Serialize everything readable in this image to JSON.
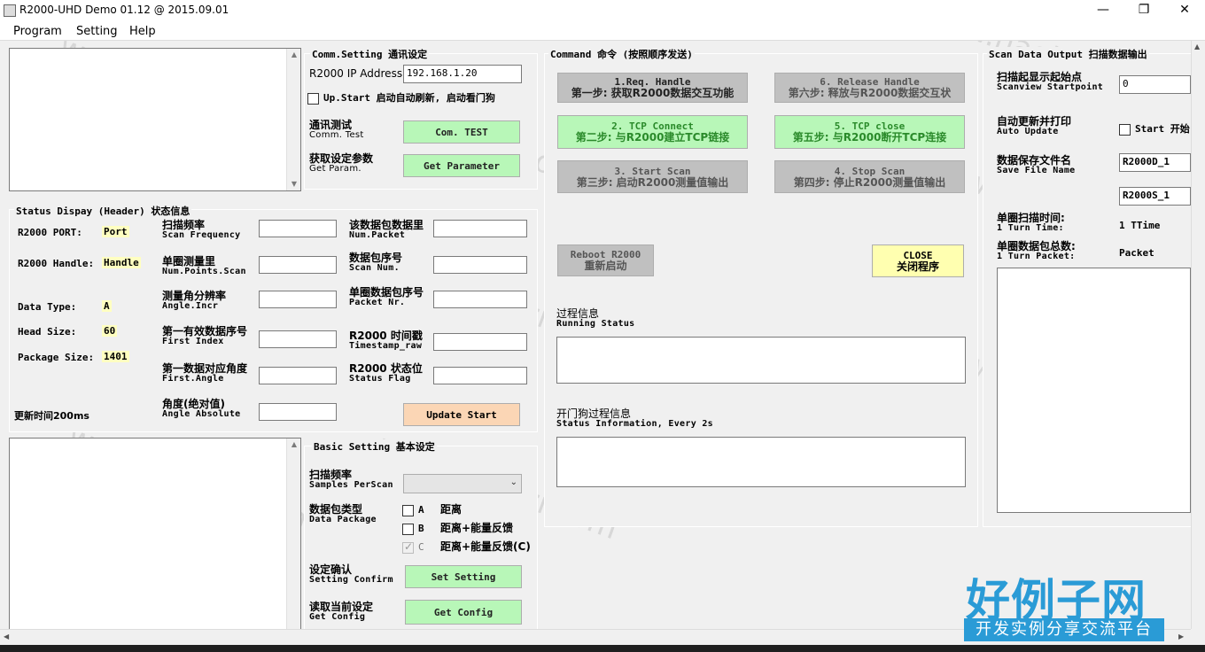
{
  "window": {
    "title": "R2000-UHD Demo 01.12 @ 2015.09.01",
    "minimize": "—",
    "maximize": "❐",
    "close": "✕"
  },
  "menu": [
    "Program",
    "Setting",
    "Help"
  ],
  "comm": {
    "title": "Comm.Setting 通讯设定",
    "ip_label": "R2000 IP Address",
    "ip_value": "192.168.1.20",
    "upstart_label": "Up.Start 启动自动刷新, 启动看门狗",
    "test_zh": "通讯测试",
    "test_en": "Comm. Test",
    "test_btn": "Com. TEST",
    "param_zh": "获取设定参数",
    "param_en": "Get Param.",
    "param_btn": "Get Parameter"
  },
  "status": {
    "title": "Status Dispay (Header) 状态信息",
    "port_label": "R2000 PORT:",
    "port_value": "Port",
    "handle_label": "R2000 Handle:",
    "handle_value": "Handle",
    "dtype_label": "Data Type:",
    "dtype_value": "A",
    "head_label": "Head Size:",
    "head_value": "60",
    "pkg_label": "Package Size:",
    "pkg_value": "1401",
    "refresh_label": "更新时间200ms",
    "fields": [
      {
        "zh": "扫描频率",
        "en": "Scan Frequency"
      },
      {
        "zh": "单圈测量里",
        "en": "Num.Points.Scan"
      },
      {
        "zh": "测量角分辨率",
        "en": "Angle.Incr"
      },
      {
        "zh": "第一有效数据序号",
        "en": "First Index"
      },
      {
        "zh": "第一数据对应角度",
        "en": "First.Angle"
      },
      {
        "zh": "角度(绝对值)",
        "en": "Angle Absolute"
      }
    ],
    "fields2": [
      {
        "zh": "该数据包数据里",
        "en": "Num.Packet"
      },
      {
        "zh": "数据包序号",
        "en": "Scan Num."
      },
      {
        "zh": "单圈数据包序号",
        "en": "Packet Nr."
      },
      {
        "zh": "R2000 时间戳",
        "en": "Timestamp_raw"
      },
      {
        "zh": "R2000 状态位",
        "en": "Status Flag"
      }
    ],
    "update_btn": "Update Start"
  },
  "basic": {
    "title": "Basic Setting 基本设定",
    "samples_zh": "扫描频率",
    "samples_en": "Samples PerScan",
    "pkg_zh": "数据包类型",
    "pkg_en": "Data Package",
    "opt_a": "A",
    "opt_a_desc": "距离",
    "opt_b": "B",
    "opt_b_desc": "距离+能量反馈",
    "opt_c": "C",
    "opt_c_desc": "距离+能量反馈(C)",
    "confirm_zh": "设定确认",
    "confirm_en": "Setting Confirm",
    "set_btn": "Set Setting",
    "read_zh": "读取当前设定",
    "read_en": "Get Config",
    "get_btn": "Get Config"
  },
  "command": {
    "title": "Command 命令 (按照顺序发送)",
    "b1_en": "1.Req. Handle",
    "b1_zh": "第一步: 获取R2000数据交互功能",
    "b2_en": "2. TCP Connect",
    "b2_zh": "第二步: 与R2000建立TCP链接",
    "b3_en": "3. Start Scan",
    "b3_zh": "第三步: 启动R2000测量值输出",
    "b4_en": "4. Stop Scan",
    "b4_zh": "第四步: 停止R2000测量值输出",
    "b5_en": "5. TCP close",
    "b5_zh": "第五步: 与R2000断开TCP连接",
    "b6_en": "6. Release Handle",
    "b6_zh": "第六步: 释放与R2000数据交互状",
    "reboot_en": "Reboot R2000",
    "reboot_zh": "重新启动",
    "close_en": "CLOSE",
    "close_zh": "关闭程序",
    "running_zh": "过程信息",
    "running_en": "Running Status",
    "watchdog_zh": "开门狗过程信息",
    "watchdog_en": "Status Information, Every 2s"
  },
  "scan": {
    "title": "Scan Data Output 扫描数据输出",
    "start_zh": "扫描起显示起始点",
    "start_en": "Scanview Startpoint",
    "start_value": "0",
    "auto_zh": "自动更新并打印",
    "auto_en": "Auto Update",
    "auto_chk": "Start 开始",
    "file_zh": "数据保存文件名",
    "file_en": "Save File Name",
    "file1": "R2000D_1",
    "file2": "R2000S_1",
    "turn_zh": "单圈扫描时间:",
    "turn_en": "1 Turn Time:",
    "turn_value": "1 TTime",
    "packet_zh": "单圈数据包总数:",
    "packet_en": "1 Turn Packet:",
    "packet_value": "Packet"
  },
  "watermark": {
    "text": "www.haolizi.com",
    "brand_big": "好例子网",
    "brand_small": "开发实例分享交流平台"
  },
  "icons": {
    "scroll_up": "chevron-up-icon",
    "scroll_down": "chevron-down-icon",
    "scroll_left": "chevron-left-icon",
    "scroll_right": "chevron-right-icon",
    "dropdown": "chevron-down-icon"
  },
  "colors": {
    "green": "#b8f7b8",
    "orange": "#fbd6b5",
    "yellow": "#ffffb0",
    "brand": "#2a9bd6"
  }
}
